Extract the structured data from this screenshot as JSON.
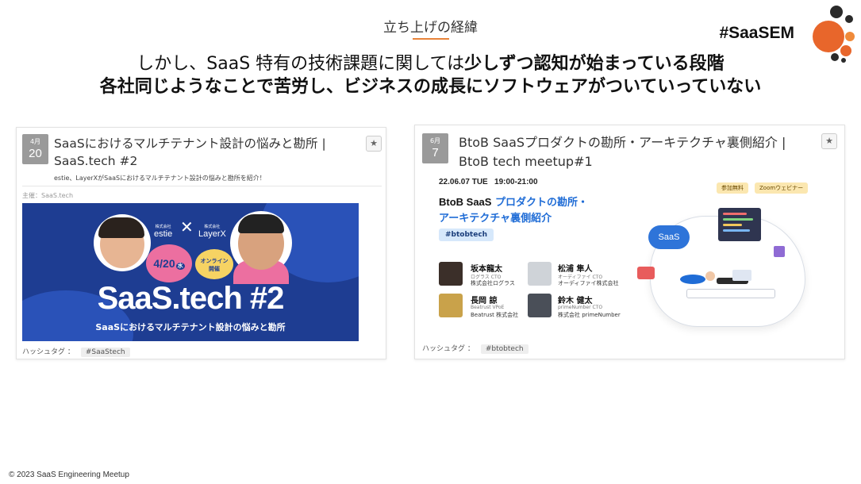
{
  "slide": {
    "section_label": "立ち上げの経緯",
    "brand_hashtag": "#SaaSEM",
    "headline_line1_part1": "しかし、SaaS 特有の技術課題に関しては",
    "headline_line1_part2": "少しずつ認知が始まっている段階",
    "headline_line2": "各社同じようなことで苦労し、ビジネスの成長にソフトウェアがついていっていない",
    "footer": "© 2023 SaaS Engineering Meetup"
  },
  "colors": {
    "accent": "#e8843a",
    "logo_orange": "#e8662b",
    "logo_dark": "#2a2a2a",
    "banner_blue": "#1e3d92",
    "event_blue": "#1f6cd6",
    "pink": "#ec6fa0"
  },
  "events": [
    {
      "month": "4月",
      "day": "20",
      "title_line1": "SaaSにおけるマルチテナント設計の悩みと勘所 |",
      "title_line2": "SaaS.tech #2",
      "description": "estie、LayerXがSaaSにおけるマルチテナント設計の悩みと勘所を紹介！",
      "host": "主催：SaaS.tech",
      "star": "★",
      "banner": {
        "brand_a_small": "株式会社",
        "brand_a": "estie",
        "cross": "✕",
        "brand_b_small": "株式会社",
        "brand_b": "LayerX",
        "date": "4/20",
        "date_suffix": "水",
        "online": "オンライン",
        "online2": "開催",
        "title": "SaaS.tech #2",
        "subtitle": "SaaSにおけるマルチテナント設計の悩みと勘所"
      },
      "hashtag_label": "ハッシュタグ ：",
      "hashtag": "#SaaStech"
    },
    {
      "month": "6月",
      "day": "7",
      "title_line1": "BtoB SaaSプロダクトの勘所・アーキテクチャ裏側紹介 |",
      "title_line2": "BtoB tech meetup#1",
      "star": "★",
      "banner": {
        "date": "22.06.07 TUE   19:00-21:00",
        "title_black": "BtoB SaaS",
        "title_blue": " プロダクトの勘所・",
        "title_line2": "アーキテクチャ裏側紹介",
        "tag": "#btobtech",
        "pill1": "参加無料",
        "pill2": "Zoomウェビナー",
        "cloud_label": "SaaS",
        "speakers": [
          {
            "name": "坂本龍太",
            "role": "ログラス CTO",
            "company": "株式会社ログラス"
          },
          {
            "name": "松浦 隼人",
            "role": "オーディファイ CTO",
            "company": "オーディファイ株式会社"
          },
          {
            "name": "長岡 諒",
            "role": "Beatrust VPoE",
            "company": "Beatrust 株式会社"
          },
          {
            "name": "鈴木 健太",
            "role": "primeNumber CTO",
            "company": "株式会社 primeNumber"
          }
        ]
      },
      "hashtag_label": "ハッシュタグ ：",
      "hashtag": "#btobtech"
    }
  ]
}
